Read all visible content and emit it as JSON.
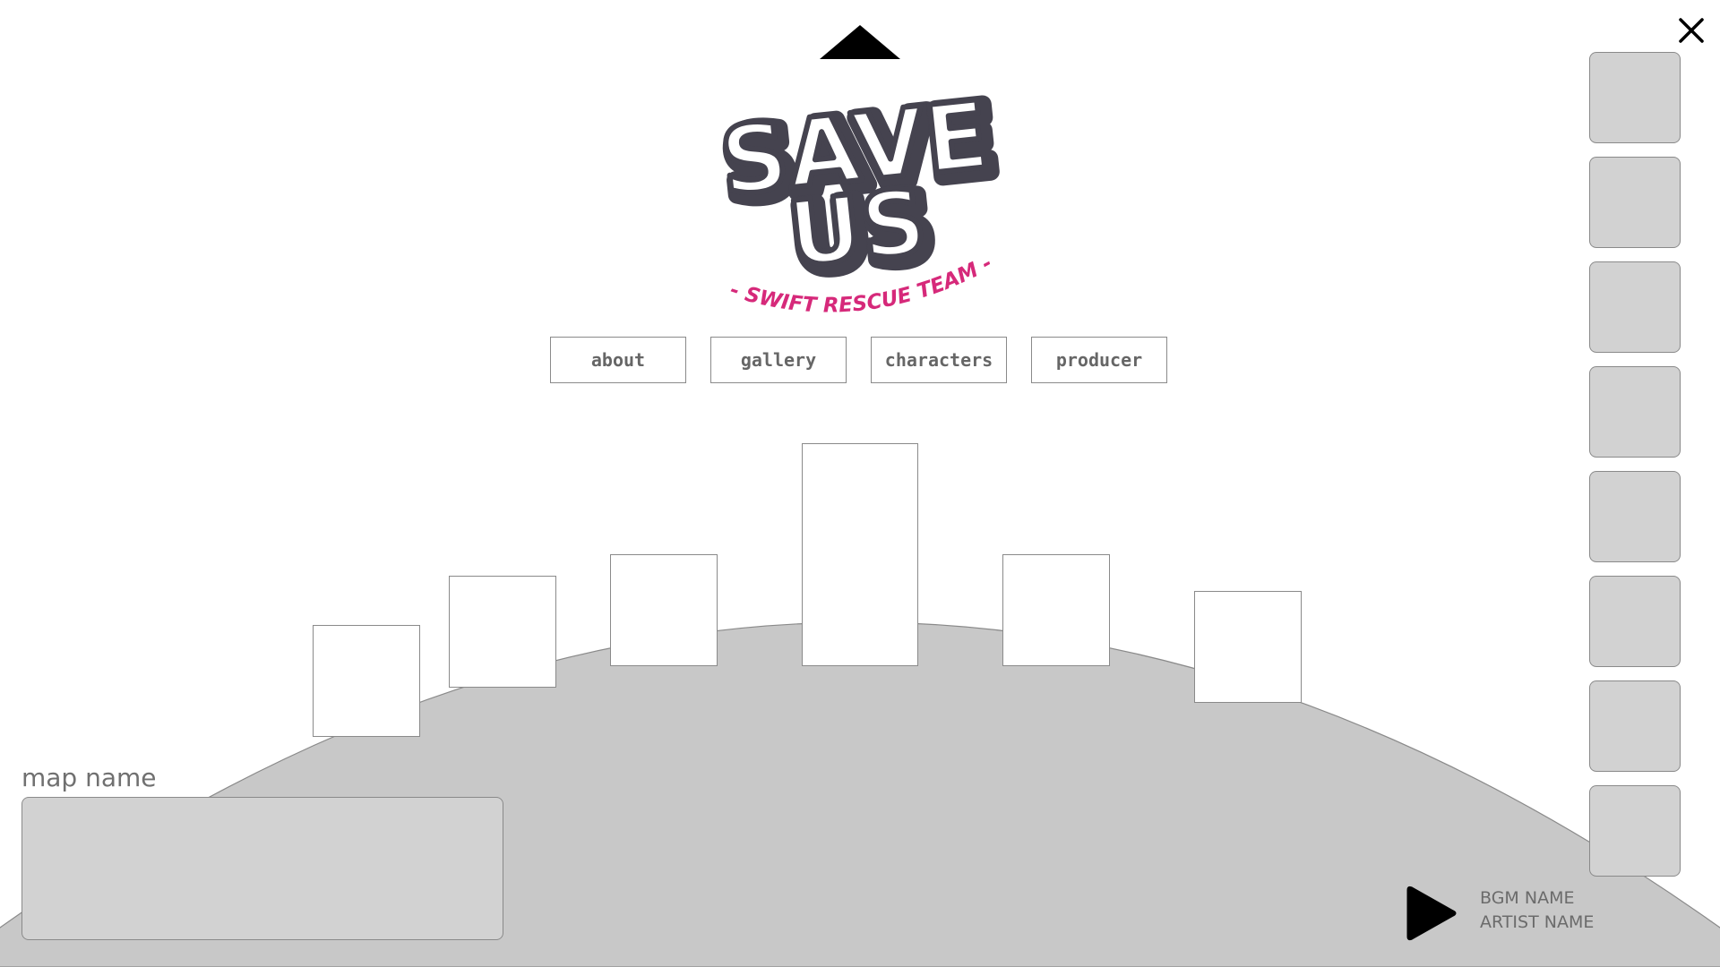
{
  "logo": {
    "line1": "SAVE",
    "line2": "US",
    "tagline": "- SWIFT RESCUE TEAM -",
    "colors": {
      "fill": "#ffffff",
      "outline": "#45434f",
      "tagline": "#d6297a"
    }
  },
  "icons": {
    "up": "triangle-up-icon",
    "close": "close-x-icon",
    "play": "play-icon"
  },
  "nav": {
    "items": [
      {
        "label": "about"
      },
      {
        "label": "gallery"
      },
      {
        "label": "characters"
      },
      {
        "label": "producer"
      }
    ]
  },
  "stages": {
    "count": 6
  },
  "side_slots": {
    "count": 8
  },
  "map": {
    "label": "map name"
  },
  "bgm": {
    "title": "BGM NAME",
    "artist": "ARTIST NAME"
  },
  "colors": {
    "hill": "#c8c8c8",
    "panel": "#d2d2d2",
    "border": "#8a8a8a",
    "text": "#707070"
  }
}
